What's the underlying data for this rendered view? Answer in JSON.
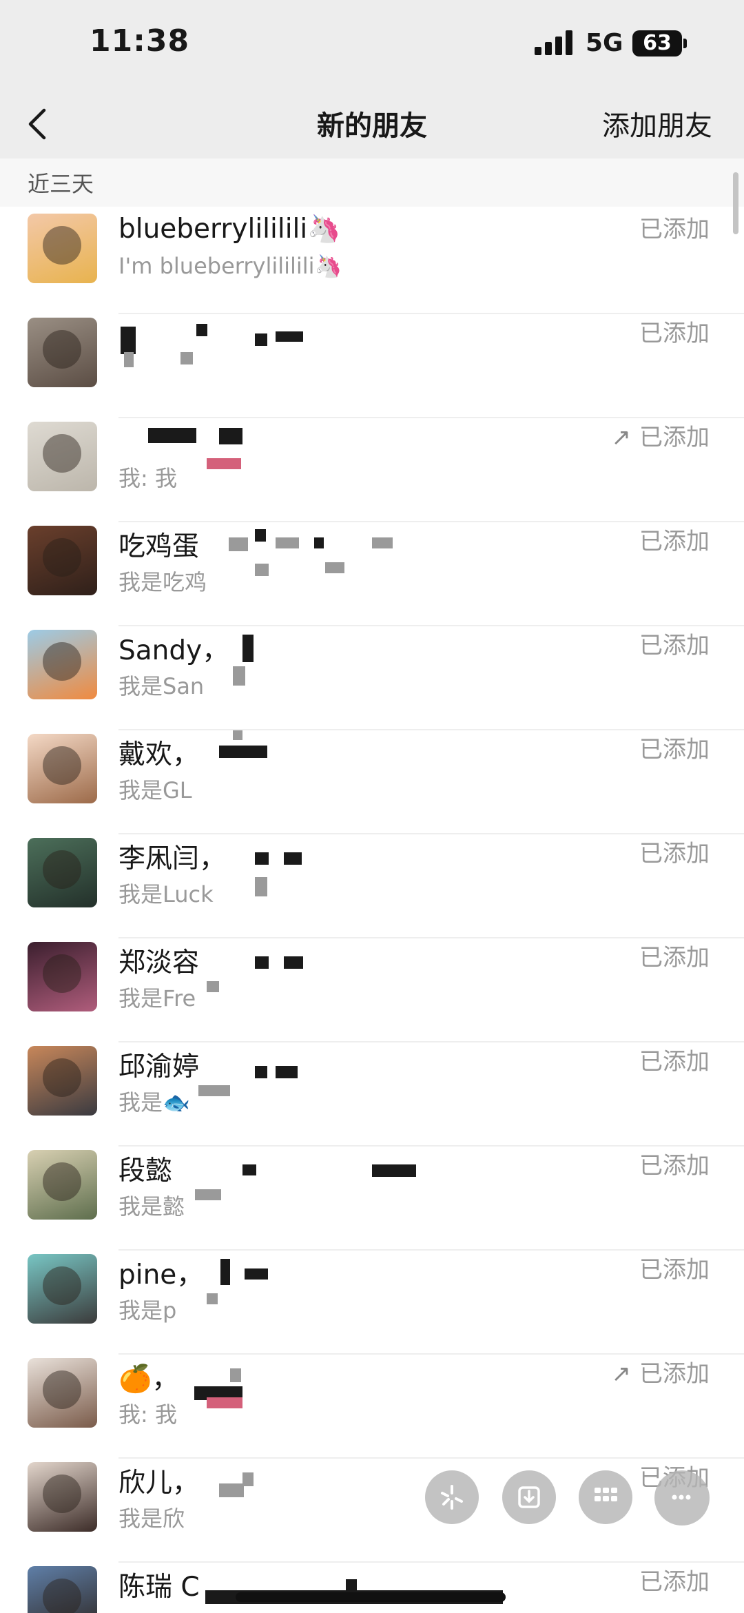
{
  "status_bar": {
    "time": "11:38",
    "network": "5G",
    "battery": "63"
  },
  "nav": {
    "title": "新的朋友",
    "action": "添加朋友"
  },
  "section": {
    "title": "近三天"
  },
  "contacts": [
    {
      "name": "blueberrylililili🦄",
      "desc": "I'm blueberrylililili🦄",
      "status": "已添加",
      "has_arrow": false,
      "colors": [
        "#f3c8a8",
        "#e8b34e"
      ]
    },
    {
      "name": "",
      "desc": "",
      "status": "已添加",
      "has_arrow": false,
      "colors": [
        "#9a8f84",
        "#5b4d44"
      ]
    },
    {
      "name": "",
      "desc": "我: 我",
      "status": "已添加",
      "has_arrow": true,
      "colors": [
        "#dedad2",
        "#bcb6ab"
      ]
    },
    {
      "name": "吃鸡蛋",
      "desc": "我是吃鸡",
      "status": "已添加",
      "has_arrow": false,
      "colors": [
        "#6a3f2c",
        "#2f201a"
      ]
    },
    {
      "name": "Sandy，",
      "desc": "我是San",
      "status": "已添加",
      "has_arrow": false,
      "colors": [
        "#9ccbe6",
        "#f08a3f"
      ]
    },
    {
      "name": "戴欢，",
      "desc": "我是GL",
      "status": "已添加",
      "has_arrow": false,
      "colors": [
        "#f4d9c6",
        "#9c6a49"
      ]
    },
    {
      "name": "李凩闫，",
      "desc": "我是Luck",
      "status": "已添加",
      "has_arrow": false,
      "colors": [
        "#4c6f5a",
        "#23302a"
      ]
    },
    {
      "name": "郑淡容",
      "desc": "我是Fre",
      "status": "已添加",
      "has_arrow": false,
      "colors": [
        "#3b1f2e",
        "#b05d7c"
      ]
    },
    {
      "name": "邱渝婷",
      "desc": "我是🐟",
      "status": "已添加",
      "has_arrow": false,
      "colors": [
        "#c8875a",
        "#3a3a40"
      ]
    },
    {
      "name": "段懿",
      "desc": "我是懿",
      "status": "已添加",
      "has_arrow": false,
      "colors": [
        "#d8d0b2",
        "#5e6e4d"
      ]
    },
    {
      "name": "pine，",
      "desc": "我是p",
      "status": "已添加",
      "has_arrow": false,
      "colors": [
        "#78c6c4",
        "#3b3b3b"
      ]
    },
    {
      "name": "🍊，",
      "desc": "我: 我",
      "status": "已添加",
      "has_arrow": true,
      "colors": [
        "#e9e1da",
        "#7a5b4a"
      ]
    },
    {
      "name": "欣儿，",
      "desc": "我是欣",
      "status": "已添加",
      "has_arrow": false,
      "colors": [
        "#e3d6cc",
        "#3c2c28"
      ]
    },
    {
      "name": "陈瑞 C",
      "desc": "",
      "status": "已添加",
      "has_arrow": false,
      "colors": [
        "#5f7fa8",
        "#2c241f"
      ]
    }
  ],
  "floating_buttons": [
    {
      "icon": "sparkle-icon"
    },
    {
      "icon": "download-icon"
    },
    {
      "icon": "grid-icon"
    },
    {
      "icon": "more-icon"
    }
  ]
}
